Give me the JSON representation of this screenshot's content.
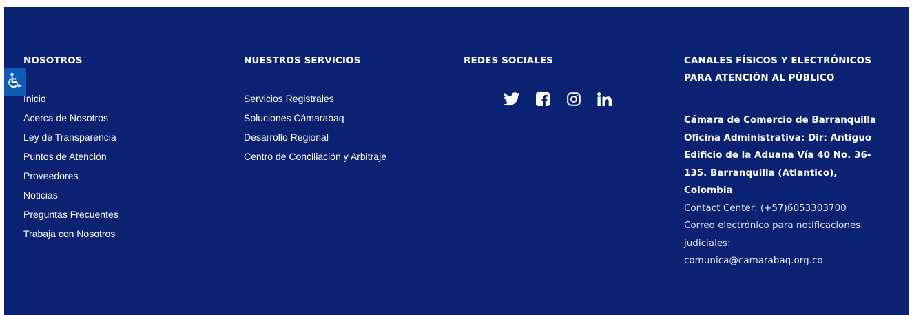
{
  "nosotros": {
    "title": "NOSOTROS",
    "links": [
      "Inicio",
      "Acerca de Nosotros",
      "Ley de Transparencia",
      "Puntos de Atención",
      "Proveedores",
      "Noticias",
      "Preguntas Frecuentes",
      "Trabaja con Nosotros"
    ]
  },
  "servicios": {
    "title": "NUESTROS SERVICIOS",
    "links": [
      "Servicios Registrales",
      "Soluciones Cámarabaq",
      "Desarrollo Regional",
      "Centro de Conciliación y Arbitraje"
    ]
  },
  "redes": {
    "title": "REDES SOCIALES",
    "icons": [
      "twitter-icon",
      "facebook-icon",
      "instagram-icon",
      "linkedin-icon"
    ]
  },
  "canales": {
    "title_line1": "CANALES FÍSICOS Y ELECTRÓNICOS",
    "title_line2": "PARA ATENCIÓN AL PÚBLICO",
    "org_lines": [
      "Cámara de Comercio de Barranquilla",
      "Oficina Administrativa: Dir: Antiguo",
      "Edificio de la Aduana Vía 40 No. 36-",
      "135. Barranquilla (Atlantico),",
      "Colombia"
    ],
    "contact_lines": [
      "Contact Center: (+57)6053303700",
      "Correo electrónico para notificaciones",
      "judiciales:",
      "comunica@camarabaq.org.co"
    ]
  },
  "accessibility": {
    "icon": "wheelchair-icon"
  },
  "colors": {
    "background": "#0b2272",
    "accessibility_button": "#0d5bb5",
    "text": "#ffffff"
  }
}
